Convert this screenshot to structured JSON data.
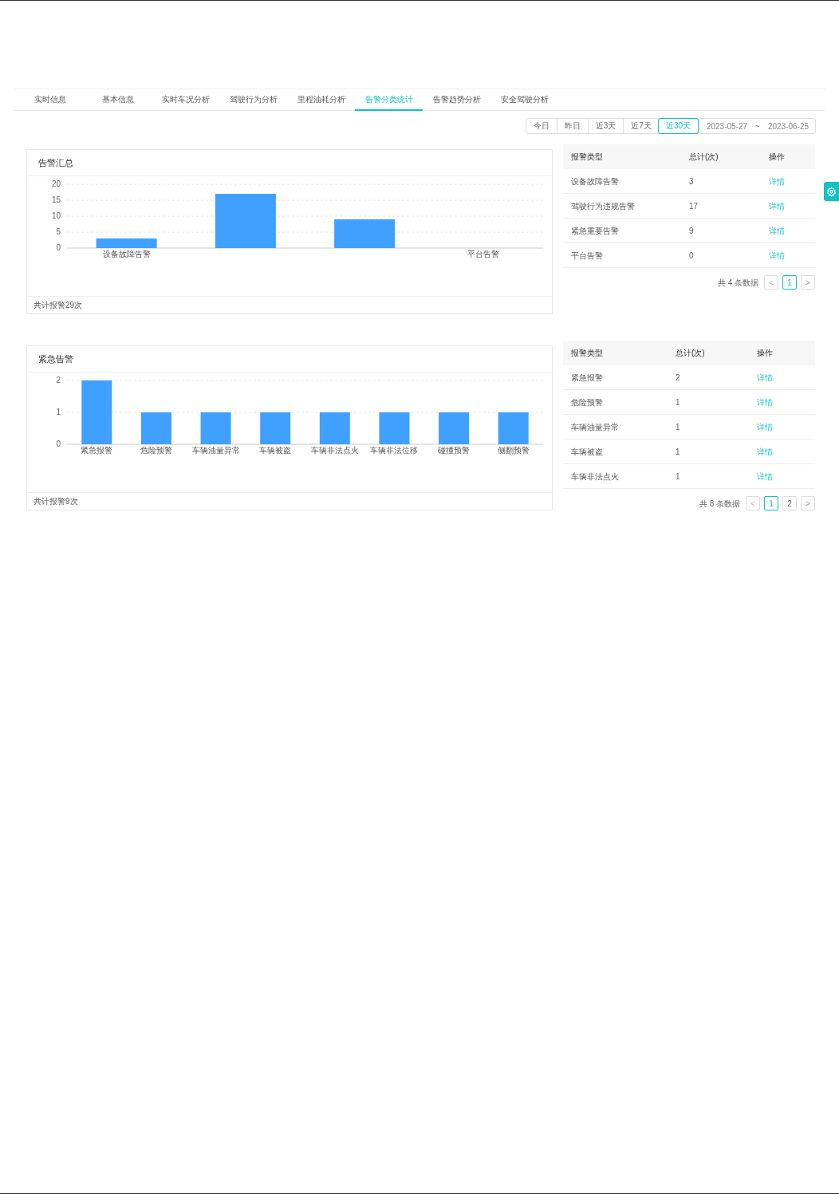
{
  "tabs": [
    {
      "label": "实时信息",
      "selected": false
    },
    {
      "label": "基本信息",
      "selected": false
    },
    {
      "label": "实时车况分析",
      "selected": false
    },
    {
      "label": "驾驶行为分析",
      "selected": false
    },
    {
      "label": "里程油耗分析",
      "selected": false
    },
    {
      "label": "告警分类统计",
      "selected": true
    },
    {
      "label": "告警趋势分析",
      "selected": false
    },
    {
      "label": "安全驾驶分析",
      "selected": false
    }
  ],
  "date_filter": {
    "ranges": [
      {
        "label": "今日",
        "selected": false
      },
      {
        "label": "昨日",
        "selected": false
      },
      {
        "label": "近3天",
        "selected": false
      },
      {
        "label": "近7天",
        "selected": false
      },
      {
        "label": "近30天",
        "selected": true
      }
    ],
    "start": "2023-05-27",
    "separator": "~",
    "end": "2023-06-25"
  },
  "sections": [
    {
      "title": "告警汇总",
      "footer": "共计报警29次",
      "chart_data": {
        "type": "bar",
        "categories": [
          "设备故障告警",
          null,
          null,
          "平台告警"
        ],
        "values": [
          3,
          17,
          9,
          0
        ],
        "grid": true,
        "ylim": [
          0,
          20
        ],
        "yticks": [
          0,
          5,
          10,
          15,
          20
        ]
      },
      "table": {
        "columns": [
          "报警类型",
          "总计(次)",
          "操作"
        ],
        "rows": [
          [
            "设备故障告警",
            "3",
            "详情"
          ],
          [
            "驾驶行为违规告警",
            "17",
            "详情"
          ],
          [
            "紧急重要告警",
            "9",
            "详情"
          ],
          [
            "平台告警",
            "0",
            "详情"
          ]
        ]
      },
      "pagination": {
        "total": "共 4 条数据",
        "prev": "<",
        "pages": [
          {
            "label": "1",
            "selected": true
          }
        ],
        "next": ">"
      }
    },
    {
      "title": "紧急告警",
      "footer": "共计报警9次",
      "chart_data": {
        "type": "bar",
        "categories": [
          "紧急报警",
          "危险预警",
          "车辆油量异常",
          "车辆被盗",
          "车辆非法点火",
          "车辆非法位移",
          "碰撞预警",
          "侧翻预警"
        ],
        "values": [
          2,
          1,
          1,
          1,
          1,
          1,
          1,
          1
        ],
        "grid": true,
        "ylim": [
          0,
          2
        ],
        "yticks": [
          0,
          1,
          2
        ]
      },
      "table": {
        "columns": [
          "报警类型",
          "总计(次)",
          "操作"
        ],
        "rows": [
          [
            "紧急报警",
            "2",
            "详情"
          ],
          [
            "危险预警",
            "1",
            "详情"
          ],
          [
            "车辆油量异常",
            "1",
            "详情"
          ],
          [
            "车辆被盗",
            "1",
            "详情"
          ],
          [
            "车辆非法点火",
            "1",
            "详情"
          ]
        ]
      },
      "pagination": {
        "total": "共 8 条数据",
        "prev": "<",
        "pages": [
          {
            "label": "1",
            "selected": true
          },
          {
            "label": "2",
            "selected": false
          }
        ],
        "next": ">"
      }
    }
  ]
}
